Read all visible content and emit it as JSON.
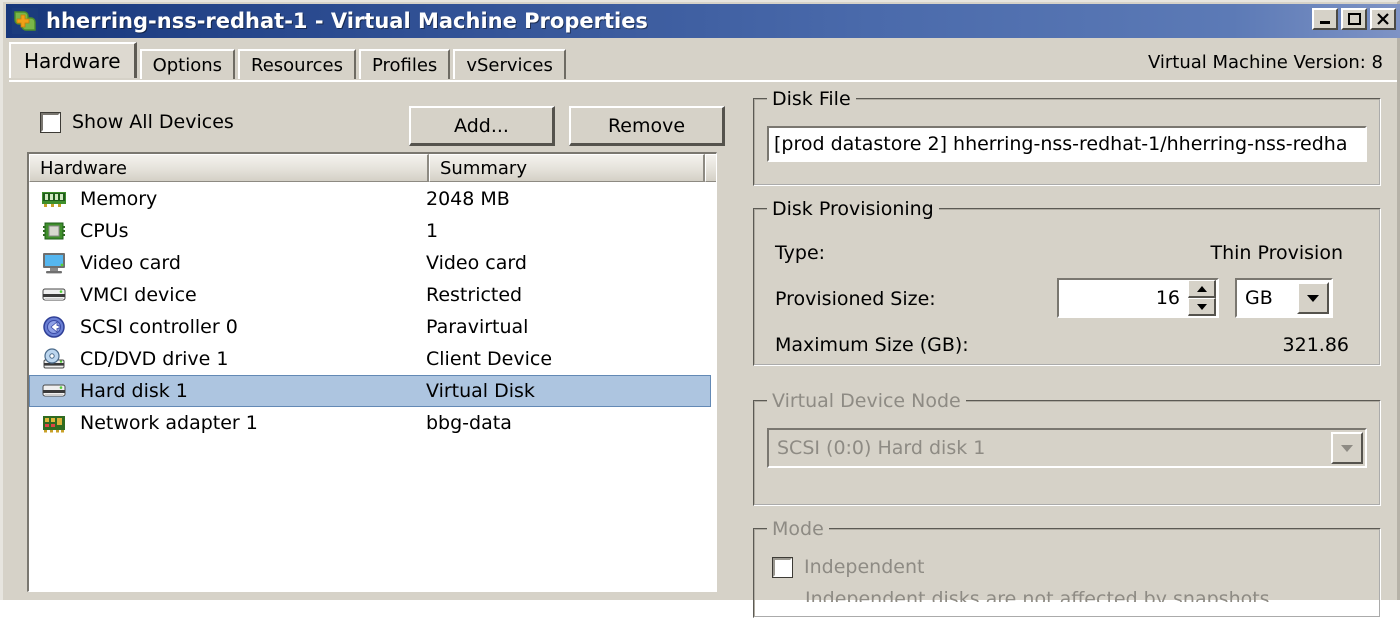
{
  "window": {
    "title": "hherring-nss-redhat-1 - Virtual Machine Properties",
    "icon": "vm-properties-icon",
    "buttons": {
      "minimize": "minimize-button",
      "maximize": "maximize-button",
      "close": "close-button"
    },
    "colors": {
      "titlebar_dark": "#17377b",
      "titlebar_light": "#7e93c5",
      "face": "#d6d2c8",
      "selection": "#adc5e0"
    }
  },
  "tabs": [
    {
      "label": "Hardware",
      "active": true
    },
    {
      "label": "Options",
      "active": false
    },
    {
      "label": "Resources",
      "active": false
    },
    {
      "label": "Profiles",
      "active": false
    },
    {
      "label": "vServices",
      "active": false
    }
  ],
  "vm_version": "Virtual Machine Version: 8",
  "toolbar": {
    "show_all_devices_label": "Show All Devices",
    "show_all_devices_checked": false,
    "add_label": "Add...",
    "remove_label": "Remove"
  },
  "hardware_list": {
    "columns": [
      "Hardware",
      "Summary"
    ],
    "rows": [
      {
        "icon": "memory-icon",
        "name": "Memory",
        "summary": "2048 MB",
        "selected": false
      },
      {
        "icon": "cpu-icon",
        "name": "CPUs",
        "summary": "1",
        "selected": false
      },
      {
        "icon": "video-card-icon",
        "name": "Video card",
        "summary": "Video card",
        "selected": false
      },
      {
        "icon": "vmci-device-icon",
        "name": "VMCI device",
        "summary": "Restricted",
        "selected": false
      },
      {
        "icon": "scsi-controller-icon",
        "name": "SCSI controller 0",
        "summary": "Paravirtual",
        "selected": false
      },
      {
        "icon": "cd-dvd-drive-icon",
        "name": "CD/DVD drive 1",
        "summary": "Client Device",
        "selected": false
      },
      {
        "icon": "hard-disk-icon",
        "name": "Hard disk 1",
        "summary": "Virtual Disk",
        "selected": true
      },
      {
        "icon": "network-adapter-icon",
        "name": "Network adapter 1",
        "summary": "bbg-data",
        "selected": false
      }
    ]
  },
  "disk_file": {
    "group_label": "Disk File",
    "value": "[prod datastore 2] hherring-nss-redhat-1/hherring-nss-redha"
  },
  "disk_provisioning": {
    "group_label": "Disk Provisioning",
    "type_label": "Type:",
    "type_value": "Thin Provision",
    "provisioned_size_label": "Provisioned Size:",
    "provisioned_size_value": "16",
    "unit_value": "GB",
    "maximum_size_label": "Maximum Size (GB):",
    "maximum_size_value": "321.86"
  },
  "virtual_device_node": {
    "group_label": "Virtual Device Node",
    "value": "SCSI (0:0) Hard disk 1",
    "disabled": true
  },
  "mode": {
    "group_label": "Mode",
    "independent_label": "Independent",
    "independent_checked": false,
    "hint": "Independent disks are not affected by snapshots.",
    "disabled": true
  }
}
